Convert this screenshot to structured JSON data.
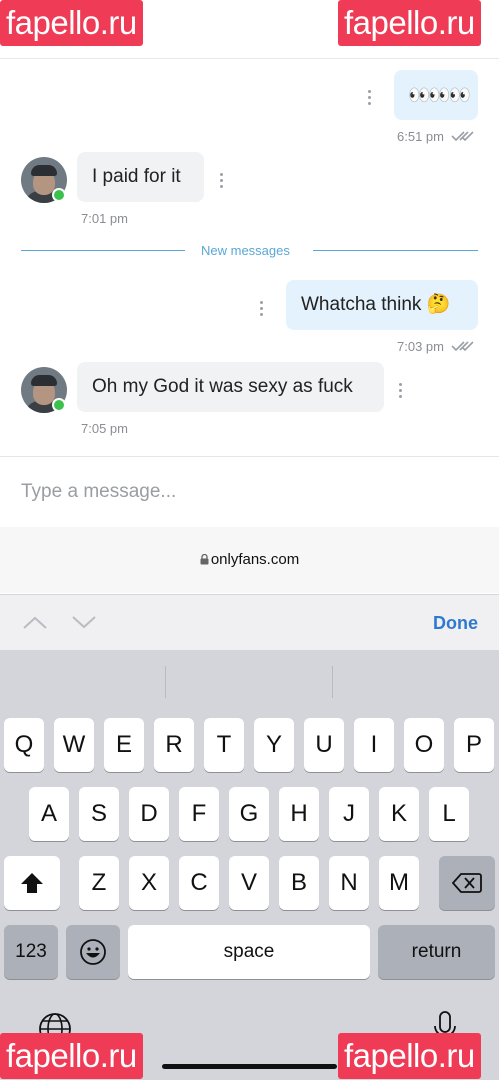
{
  "watermarks": [
    "fapello.ru",
    "fapello.ru",
    "fapello.ru",
    "fapello.ru"
  ],
  "messages": [
    {
      "direction": "out",
      "text": "👀👀👀",
      "time": "6:51 pm",
      "read": true
    },
    {
      "direction": "in",
      "text": "I paid for it",
      "time": "7:01 pm"
    },
    {
      "direction": "out",
      "text": "Whatcha think 🤔",
      "time": "7:03 pm",
      "read": true
    },
    {
      "direction": "in",
      "text": "Oh my God it was sexy as fuck",
      "time": "7:05 pm"
    }
  ],
  "divider_label": "New messages",
  "composer": {
    "placeholder": "Type a message..."
  },
  "browser": {
    "url": "onlyfans.com",
    "lock_icon": "lock-icon"
  },
  "accessory": {
    "done_label": "Done",
    "prev_icon": "chevron-up-icon",
    "next_icon": "chevron-down-icon"
  },
  "keyboard": {
    "row1": [
      "Q",
      "W",
      "E",
      "R",
      "T",
      "Y",
      "U",
      "I",
      "O",
      "P"
    ],
    "row2": [
      "A",
      "S",
      "D",
      "F",
      "G",
      "H",
      "J",
      "K",
      "L"
    ],
    "row3": [
      "Z",
      "X",
      "C",
      "V",
      "B",
      "N",
      "M"
    ],
    "numbers_label": "123",
    "space_label": "space",
    "return_label": "return"
  },
  "colors": {
    "accent": "#2f7ad0",
    "outgoing_bubble": "#e3f2fc",
    "online": "#3cc14d",
    "watermark": "#ef3b56"
  }
}
